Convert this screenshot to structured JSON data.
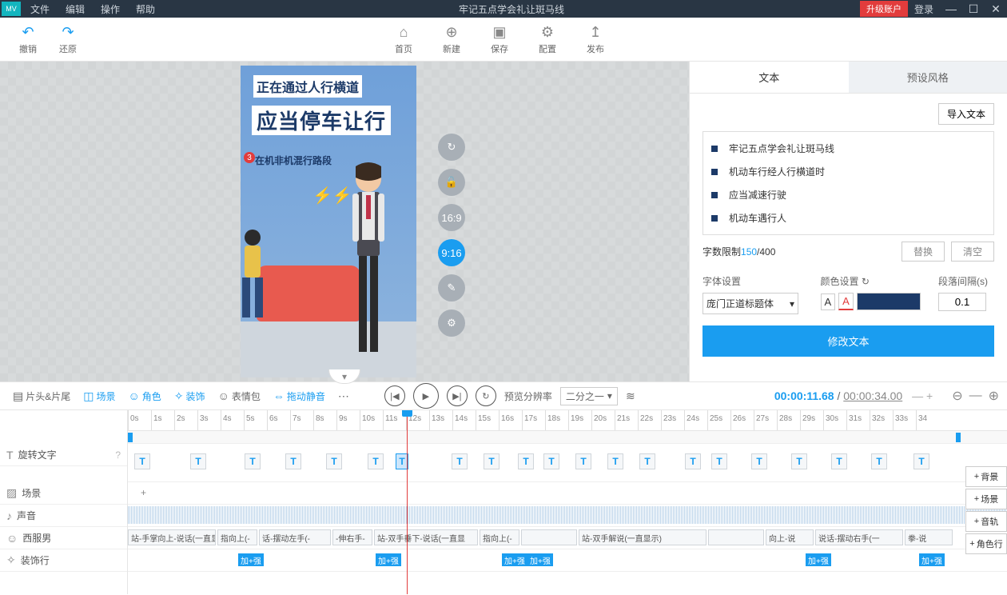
{
  "titlebar": {
    "logo": "MV",
    "menus": [
      "文件",
      "编辑",
      "操作",
      "帮助"
    ],
    "title": "牢记五点学会礼让斑马线",
    "upgrade": "升级账户",
    "login": "登录"
  },
  "toolbar": {
    "undo": "撤销",
    "redo": "还原",
    "home": "首页",
    "new": "新建",
    "save": "保存",
    "config": "配置",
    "publish": "发布"
  },
  "stage": {
    "line1": "正在通过人行横道",
    "line2": "应当停车让行",
    "badge": "3",
    "line3": "在机非机混行路段",
    "ratio1": "16:9",
    "ratio2": "9:16"
  },
  "right": {
    "tab_text": "文本",
    "tab_preset": "预设风格",
    "import": "导入文本",
    "items": [
      "牢记五点学会礼让斑马线",
      "机动车行经人行横道时",
      "应当减速行驶",
      "机动车遇行人"
    ],
    "limit_label": "字数限制",
    "limit_count": "150",
    "limit_max": "/400",
    "replace": "替换",
    "clear": "清空",
    "font_label": "字体设置",
    "font_val": "庞门正道标题体",
    "color_label": "颜色设置",
    "spacing_label": "段落间隔(s)",
    "spacing_val": "0.1",
    "modify": "修改文本",
    "color_hex": "#1c3a68"
  },
  "tlheader": {
    "tools": [
      {
        "label": "片头&片尾"
      },
      {
        "label": "场景"
      },
      {
        "label": "角色"
      },
      {
        "label": "装饰"
      },
      {
        "label": "表情包"
      },
      {
        "label": "拖动静音"
      }
    ],
    "rate_label": "预览分辨率",
    "rate_val": "二分之一",
    "time_cur": "00:00:11.68",
    "time_sep": " / ",
    "time_tot": "00:00:34.00"
  },
  "tracks": {
    "ruler": [
      "0s",
      "1s",
      "2s",
      "3s",
      "4s",
      "5s",
      "6s",
      "7s",
      "8s",
      "9s",
      "10s",
      "11s",
      "12s",
      "13s",
      "14s",
      "15s",
      "16s",
      "17s",
      "18s",
      "19s",
      "20s",
      "21s",
      "22s",
      "23s",
      "24s",
      "25s",
      "26s",
      "27s",
      "28s",
      "29s",
      "30s",
      "31s",
      "32s",
      "33s",
      "34"
    ],
    "rotate": "旋转文字",
    "scene": "场景",
    "sound": "声音",
    "char": "西服男",
    "deco": "装饰行",
    "char_clips": [
      "站-手掌向上-说话(一直显",
      "指向上(-",
      "话-摆动左手(-",
      "-伸右手-",
      "站-双手垂下-说话(一直显",
      "指向上(-",
      "",
      "站-双手解说(一直显示)",
      "",
      "向上-说",
      "说话-摆动右手(一",
      "拳-说"
    ],
    "deco_label": "加+强",
    "add_bg": "背景",
    "add_scene": "场景",
    "add_track": "音轨",
    "add_role": "角色行"
  }
}
